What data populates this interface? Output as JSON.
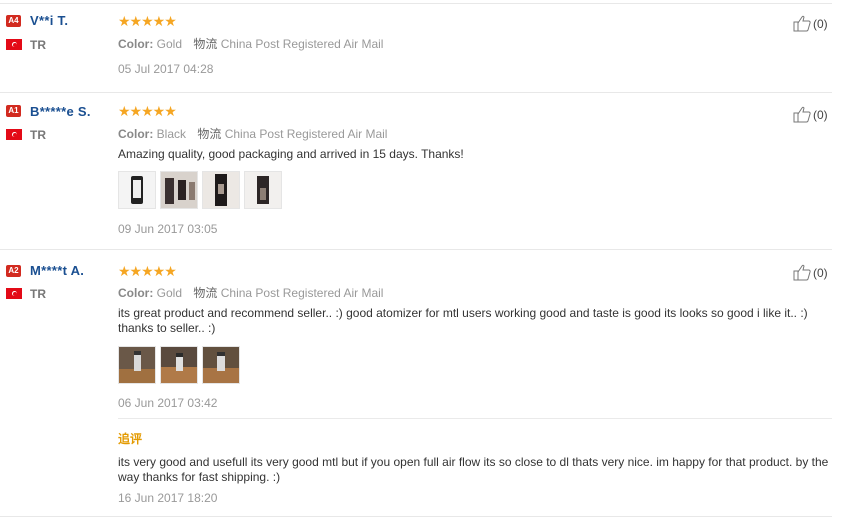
{
  "reviews": [
    {
      "level": "A4",
      "user": "V**i T.",
      "country": "TR",
      "color_key": "Color:",
      "color_val": "Gold",
      "ship_cn": "物流",
      "ship": "China Post Registered Air Mail",
      "text": "",
      "date": "05 Jul 2017 04:28",
      "likes": "(0)"
    },
    {
      "level": "A1",
      "user": "B*****e S.",
      "country": "TR",
      "color_key": "Color:",
      "color_val": "Black",
      "ship_cn": "物流",
      "ship": "China Post Registered Air Mail",
      "text": "Amazing quality, good packaging and arrived in 15 days. Thanks!",
      "date": "09 Jun 2017 03:05",
      "likes": "(0)"
    },
    {
      "level": "A2",
      "user": "M****t A.",
      "country": "TR",
      "color_key": "Color:",
      "color_val": "Gold",
      "ship_cn": "物流",
      "ship": "China Post Registered Air Mail",
      "text": "its great product and recommend seller.. :) good atomizer for mtl users working good and taste is good its looks so good i like it.. :) thanks to seller.. :)",
      "date": "06 Jun 2017 03:42",
      "likes": "(0)",
      "additional_label": "追评",
      "additional_text": "its very good and usefull its very good mtl but if you open full air flow its so close to dl thats very nice. im happy for that product. by the way thanks for fast shipping. :)",
      "additional_date": "16 Jun 2017 18:20"
    }
  ],
  "stars_glyph": "★★★★★",
  "colors": {
    "accent_star": "#f5a623",
    "username": "#1a4f91",
    "level_badge": "#d22a1f",
    "followup": "#e39a00"
  },
  "icons": {
    "like": "thumbs-up-icon",
    "flag": "turkey-flag-icon"
  }
}
